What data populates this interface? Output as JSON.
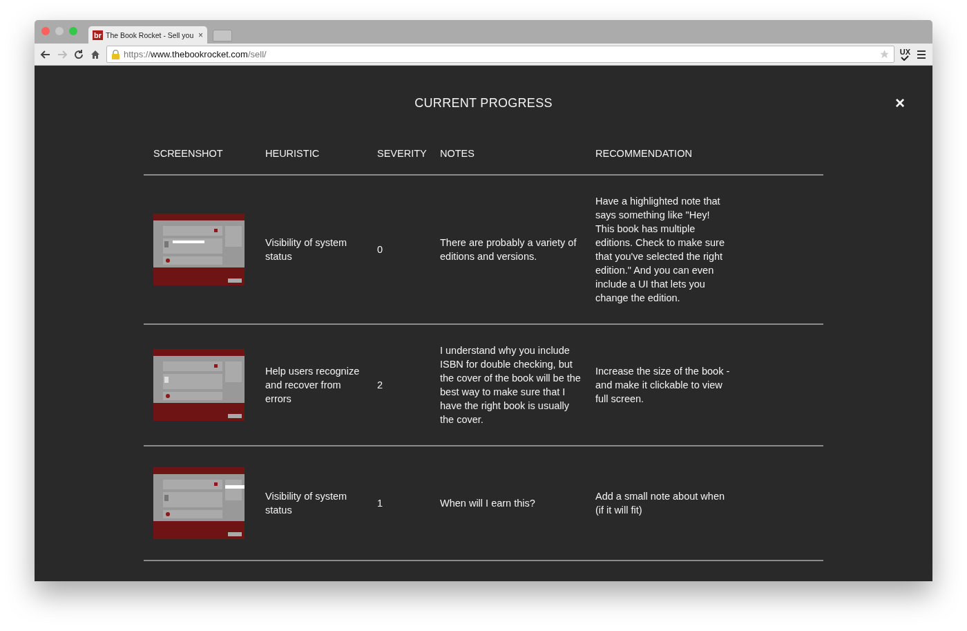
{
  "browser": {
    "tab": {
      "favicon": "br",
      "title": "The Book Rocket - Sell you",
      "close": "×"
    },
    "url": {
      "scheme": "https://",
      "host": "www.thebookrocket.com",
      "path": "/sell/"
    },
    "extension": "UX"
  },
  "modal": {
    "title": "CURRENT PROGRESS",
    "close": "×",
    "columns": [
      "SCREENSHOT",
      "HEURISTIC",
      "SEVERITY",
      "NOTES",
      "RECOMMENDATION"
    ],
    "rows": [
      {
        "heuristic": "Visibility of system status",
        "severity": "0",
        "notes": "There are probably a variety of editions and versions.",
        "recommendation": "Have a highlighted note that says something like \"Hey! This book has multiple editions. Check to make sure that you've selected the right edition.\" And you can even include a UI that lets you change the edition."
      },
      {
        "heuristic": "Help users recognize and recover from errors",
        "severity": "2",
        "notes": "I understand why you include ISBN for double checking, but the cover of the book will be the best way to make sure that I have the right book is usually the cover.",
        "recommendation": "Increase the size of the book - and make it clickable to view full screen."
      },
      {
        "heuristic": "Visibility of system status",
        "severity": "1",
        "notes": "When will I earn this?",
        "recommendation": "Add a small note about when (if it will fit)"
      }
    ]
  }
}
